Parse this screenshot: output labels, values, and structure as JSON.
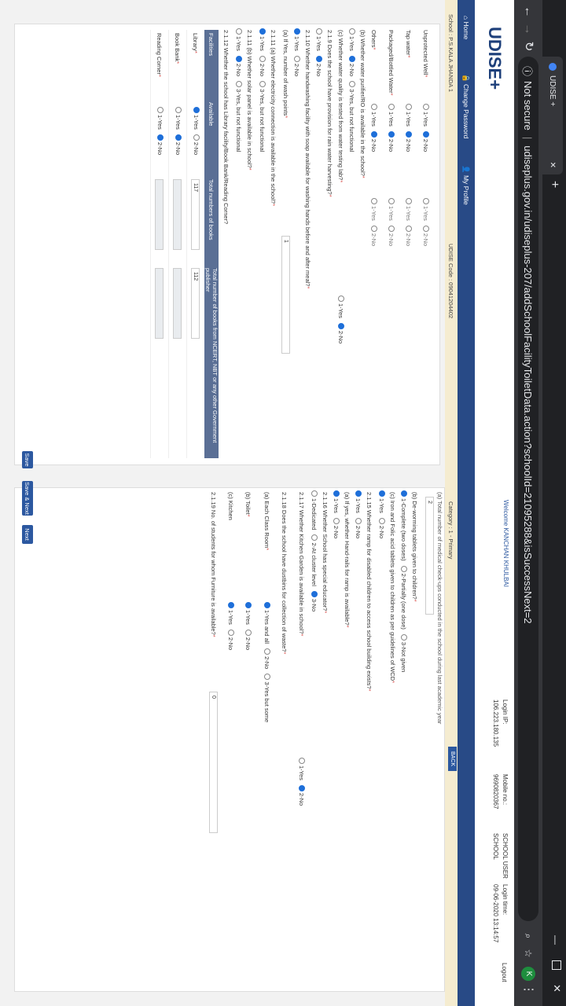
{
  "browser": {
    "tab_title": "UDISE +",
    "not_secure": "Not secure",
    "url": "udiseplus.gov.in/udiseplus-207/addSchoolFacilityToiletData.action?schoolId=21095288&isSuccessNext=2",
    "profile_initial": "K"
  },
  "header": {
    "logo": "UDISE+",
    "welcome": "Welcome KANCHAN KHULBAI",
    "login_ip_label": "Login IP:",
    "login_ip": "106.223.180.135",
    "mobile_label": "Mobile no.:",
    "mobile": "9690820367",
    "role_label": "SCHOOL USER",
    "role_sub": "SCHOOL",
    "login_time_label": "Login time:",
    "login_time": "09-06-2020 13:14:57",
    "logout": "Logout"
  },
  "nav": {
    "home": "Home",
    "change_password": "Change Password",
    "my_profile": "My Profile"
  },
  "info": {
    "school": "School : P.S.KALA JHANDA 1",
    "udise_code": "UDISE Code : 09041204402",
    "category": "Category : 1 - Primary",
    "back": "BACK"
  },
  "left": {
    "water_rows": [
      {
        "label": "Unprotected Well",
        "a": [
          "1-Yes",
          "2-No"
        ],
        "a_sel": 1,
        "b": [
          "1-Yes",
          "2-No"
        ],
        "b_sel": -1
      },
      {
        "label": "Tap water",
        "a": [
          "1-Yes",
          "2-No"
        ],
        "a_sel": 1,
        "b": [
          "1-Yes",
          "2-No"
        ],
        "b_sel": -1
      },
      {
        "label": "Packaged/Bottled Water",
        "a": [
          "1-Yes",
          "2-No"
        ],
        "a_sel": 1,
        "b": [
          "1-Yes",
          "2-No"
        ],
        "b_sel": -1
      },
      {
        "label": "Others",
        "a": [
          "1-Yes",
          "2-No"
        ],
        "a_sel": 1,
        "b": [
          "1-Yes",
          "2-No"
        ],
        "b_sel": -1
      }
    ],
    "q_ro": "(b) Whether water purifier/RO is available in the school?",
    "q_ro_opts": [
      "1-Yes",
      "2-No",
      "3-Yes, but not functional"
    ],
    "q_ro_sel": 1,
    "q_test": "(c) Whether water quality is tested from water testing lab?",
    "q_test_opts": [
      "1-Yes",
      "2-No"
    ],
    "q_test_sel": 1,
    "q_219": "2.1.9 Does the school have provision for rain water harvesting?",
    "q_219_opts": [
      "1-Yes",
      "2-No"
    ],
    "q_219_sel": 1,
    "q_2110": "2.1.10 Whether handwashing facility with soap available for washing hands before and after meal?",
    "q_2110_opts": [
      "1-Yes",
      "2-No"
    ],
    "q_2110_sel": 0,
    "q_wash": "(a) If Yes, number of wash points",
    "q_wash_val": "1",
    "q_2111": "2.1.11 (a) Whether electricity connection is available in the school?",
    "q_2111_opts": [
      "1-Yes",
      "2-No",
      "3-Yes, but not functional"
    ],
    "q_2111_sel": 0,
    "q_2111b": "2.1.11 (b) Whether solar panel is available in school?",
    "q_2111b_opts": [
      "1-Yes",
      "2-No",
      "3-Yes, but not functional"
    ],
    "q_2111b_sel": 1,
    "q_2112": "2.1.12 Whether the school has Library facility/Book Bank/Reading Corner?",
    "table_headers": [
      "Facilities",
      "Available",
      "Total numbers of books",
      "Total number of books from NCERT, NBT or any other Government publisher"
    ],
    "table_rows": [
      {
        "facility": "Library",
        "opts": [
          "1-Yes",
          "2-No"
        ],
        "sel": 0,
        "books": "117",
        "govt": "112"
      },
      {
        "facility": "Book Bank",
        "opts": [
          "1-Yes",
          "2-No"
        ],
        "sel": 1,
        "books": "",
        "govt": ""
      },
      {
        "facility": "Reading Corner",
        "opts": [
          "1-Yes",
          "2-No"
        ],
        "sel": 1,
        "books": "",
        "govt": ""
      }
    ]
  },
  "right": {
    "q_top": "(a) Total number of medical check-ups conducted in the school during last academic year",
    "q_top_val": "2",
    "q_deworm": "(b) De-worming tablets given to children?",
    "q_deworm_opts": [
      "1-Complete (two doses)",
      "2-Partially (one dose)",
      "3-Not given"
    ],
    "q_deworm_sel": 0,
    "q_iron": "(c) Iron and Folic acid tablets given to children as per guidelines of WCD",
    "q_iron_opts": [
      "1-Yes",
      "2-No"
    ],
    "q_iron_sel": 0,
    "q_2115": "2.1.15 Whether ramp for disabled children to access school building exists?",
    "q_2115_opts": [
      "1-Yes",
      "2-No"
    ],
    "q_2115_sel": 0,
    "q_hand": "(a) If yes, whether Hand-rails for ramp is available?",
    "q_hand_opts": [
      "1-Yes",
      "2-No"
    ],
    "q_hand_sel": 0,
    "q_2116": "2.1.16 Whether School has special educator?",
    "q_2116_opts": [
      "1-Dedicated",
      "2-At cluster level",
      "3-No"
    ],
    "q_2116_sel": 2,
    "q_2117": "2.1.17 Whether Kitchen Garden is available in school?",
    "q_2117_opts": [
      "1-Yes",
      "2-No"
    ],
    "q_2117_sel": 1,
    "q_2118": "2.1.18 Does the school have dustbins for collection of waste?",
    "q_class": "(a) Each Class Room",
    "q_class_opts": [
      "1-Yes and all",
      "2-No",
      "3-Yes but some"
    ],
    "q_class_sel": 0,
    "q_toilet": "(b) Toilet",
    "q_toilet_opts": [
      "1-Yes",
      "2-No"
    ],
    "q_toilet_sel": 0,
    "q_kitchen": "(c) Kitchen",
    "q_kitchen_opts": [
      "1-Yes",
      "2-No"
    ],
    "q_kitchen_sel": 0,
    "q_2119": "2.1.19 No. of students for whom Furniture is available?",
    "q_2119_val": "0"
  },
  "buttons": {
    "save": "Save",
    "save_next": "Save & Next",
    "next": "Next"
  }
}
